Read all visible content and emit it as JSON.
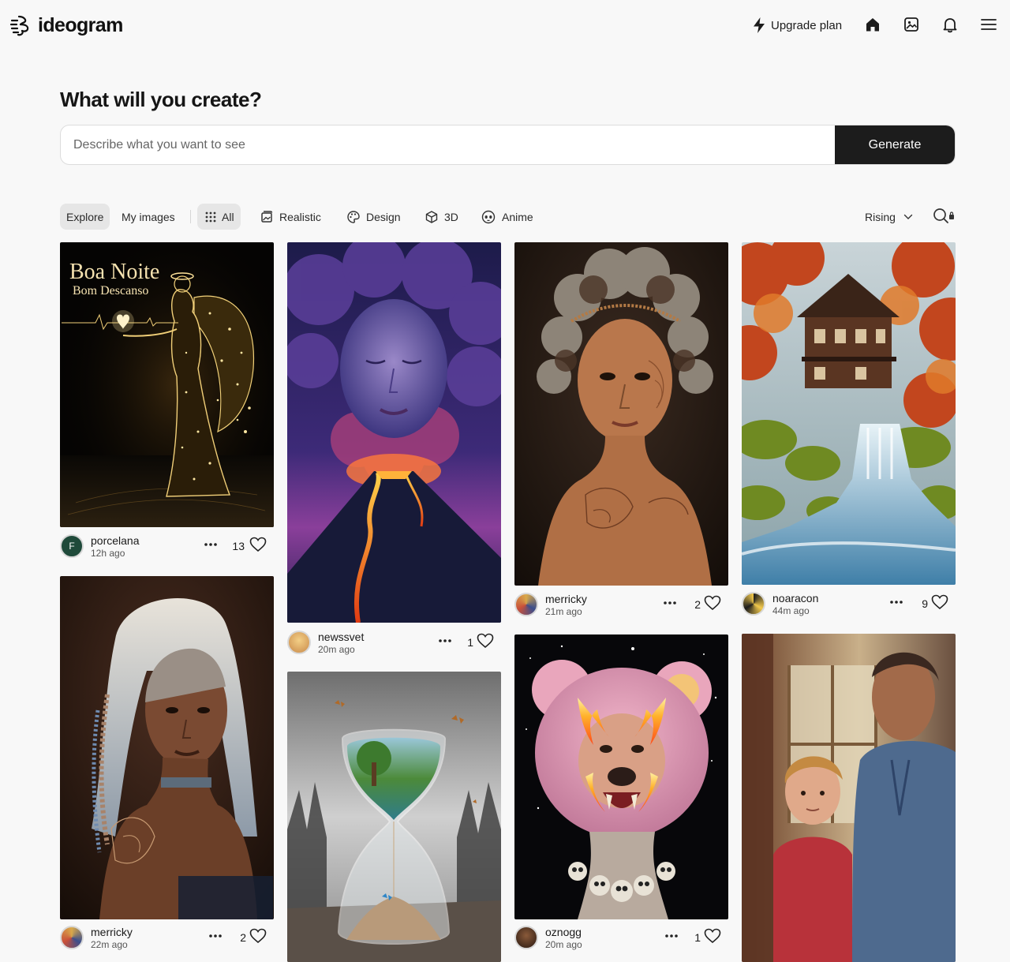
{
  "header": {
    "logo_text": "ideogram",
    "upgrade_label": "Upgrade plan",
    "icons": [
      "bolt-icon",
      "home-icon",
      "gallery-icon",
      "bell-icon",
      "menu-icon"
    ]
  },
  "prompt": {
    "title": "What will you create?",
    "placeholder": "Describe what you want to see",
    "value": "",
    "generate_label": "Generate"
  },
  "filters": {
    "tabs": [
      {
        "label": "Explore",
        "active": true
      },
      {
        "label": "My images",
        "active": false
      }
    ],
    "categories": [
      {
        "label": "All",
        "icon": "grid-icon",
        "active": true
      },
      {
        "label": "Realistic",
        "icon": "photo-stack-icon",
        "active": false
      },
      {
        "label": "Design",
        "icon": "palette-icon",
        "active": false
      },
      {
        "label": "3D",
        "icon": "cube-icon",
        "active": false
      },
      {
        "label": "Anime",
        "icon": "anime-face-icon",
        "active": false
      }
    ],
    "sort_value": "Rising",
    "search_icon": "search-icon"
  },
  "overlay_text": {
    "line1": "Boa Noite",
    "line2": "Bom Descanso"
  },
  "cards": [
    {
      "user": "porcelana",
      "time": "12h ago",
      "likes": "13",
      "avatar_initial": "F",
      "image": "golden angel of stars"
    },
    {
      "user": "newssvet",
      "time": "20m ago",
      "likes": "1",
      "image": "smoke face over erupting volcano"
    },
    {
      "user": "merricky",
      "time": "21m ago",
      "likes": "2",
      "image": "girl with curly hair and henna tattoos"
    },
    {
      "user": "noaracon",
      "time": "44m ago",
      "likes": "9",
      "image": "house above autumn waterfall"
    },
    {
      "user": "merricky",
      "time": "22m ago",
      "likes": "2",
      "image": "woman with white braids and tattoos"
    },
    {
      "user": "oznogg",
      "time": "20m ago",
      "likes": "1",
      "image": "pink bear head with flames"
    }
  ],
  "colors": {
    "background": "#f8f8f8",
    "generate_button": "#1c1c1c",
    "active_chip": "#e6e6e6",
    "avatar_green": "#1f4a3a"
  }
}
